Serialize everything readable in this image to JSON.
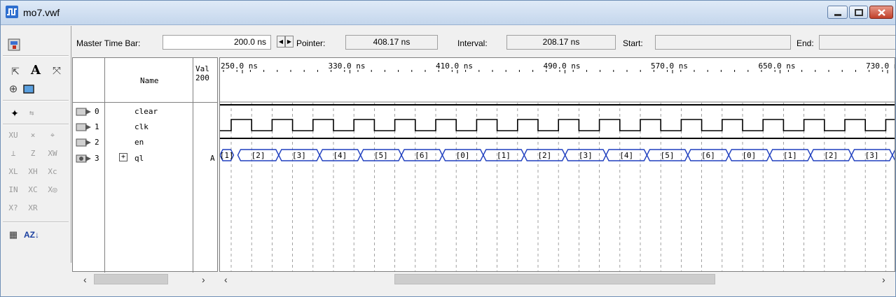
{
  "window": {
    "title": "mo7.vwf",
    "icon": "waveform-app-icon",
    "buttons": [
      "minimize",
      "maximize",
      "close"
    ]
  },
  "tools": {
    "icons": [
      "selection-icon",
      "text-tool-icon",
      "waveform-editing-icon",
      "zoom-icon",
      "full-screen-icon",
      "find-icon",
      "replace-icon",
      "forcing-unknown-icon",
      "forcing-low-icon",
      "forcing-high-icon",
      "weak-low-icon",
      "weak-high-icon",
      "weak-unknown-icon",
      "weak-0-icon",
      "high-impedance-icon",
      "invert-icon",
      "count-value-icon",
      "clock-value-icon",
      "arbitrary-value-icon",
      "random-value-icon",
      "snap-to-grid-icon",
      "sort-icon"
    ]
  },
  "topbar": {
    "master_label": "Master Time Bar:",
    "master_value": "200.0 ns",
    "pointer_label": "Pointer:",
    "pointer_value": "408.17 ns",
    "interval_label": "Interval:",
    "interval_value": "208.17 ns",
    "start_label": "Start:",
    "start_value": "",
    "end_label": "End:",
    "end_value": ""
  },
  "table": {
    "name_header": "Name",
    "value_header_1": "Val",
    "value_header_2": "200",
    "rows": [
      {
        "index": "0",
        "name": "clear",
        "value": "",
        "type": "input"
      },
      {
        "index": "1",
        "name": "clk",
        "value": "",
        "type": "input"
      },
      {
        "index": "2",
        "name": "en",
        "value": "",
        "type": "input"
      },
      {
        "index": "3",
        "name": "ql",
        "value": "A",
        "type": "bus",
        "expand": "+"
      }
    ]
  },
  "timeline": {
    "ticks": [
      "250.0 ns",
      "330.0 ns",
      "410.0 ns",
      "490.0 ns",
      "570.0 ns",
      "650.0 ns",
      "730.0 ns"
    ],
    "bus_values": [
      "1",
      "2",
      "3",
      "4",
      "5",
      "6",
      "0",
      "1",
      "2",
      "3",
      "4",
      "5",
      "6",
      "0",
      "1",
      "2",
      "3",
      "4"
    ]
  },
  "colors": {
    "bus": "#1f3fbf",
    "grid": "#7f7f7f",
    "title_accent": "#dfeaf7"
  }
}
